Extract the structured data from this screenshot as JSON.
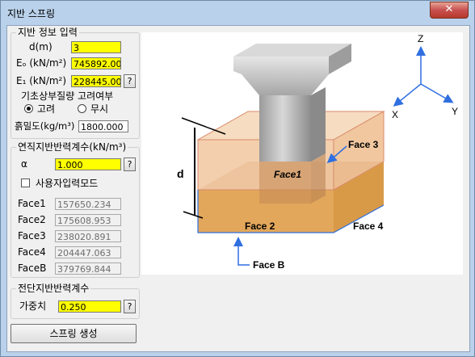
{
  "window": {
    "title": "지반 스프링",
    "close_label": "✕"
  },
  "soil_info": {
    "title": "지반 정보 입력",
    "d_label": "d(m)",
    "d_value": "3",
    "e0_label": "Eₒ (kN/m²)",
    "e0_value": "745892.000",
    "e1_label": "E₁ (kN/m²)",
    "e1_value": "228445.000",
    "e1_help": "?",
    "mass_label": "기초상부질량 고려여부",
    "radio_consider": "고려",
    "radio_ignore": "무시",
    "selected": "고려",
    "density_label": "흙밀도(kg/m³)",
    "density_value": "1800.000"
  },
  "vertical": {
    "title": "연직지반반력계수(kN/m³)",
    "alpha_label": "α",
    "alpha_value": "1.000",
    "alpha_help": "?",
    "user_mode_label": "사용자입력모드",
    "user_mode_checked": false,
    "faces": [
      {
        "label": "Face1",
        "value": "157650.234"
      },
      {
        "label": "Face2",
        "value": "175608.953"
      },
      {
        "label": "Face3",
        "value": "238020.891"
      },
      {
        "label": "Face4",
        "value": "204447.063"
      },
      {
        "label": "FaceB",
        "value": "379769.844"
      }
    ]
  },
  "shear": {
    "title": "전단지반반력계수",
    "weight_label": "가중치",
    "weight_value": "0.250",
    "weight_help": "?"
  },
  "generate_button": "스프링 생성",
  "diagram": {
    "axis_z": "Z",
    "axis_y": "Y",
    "axis_x": "X",
    "dim_d": "d",
    "face1": "Face1",
    "face2": "Face 2",
    "face3": "Face 3",
    "face4": "Face 4",
    "faceB": "Face B"
  },
  "colors": {
    "highlight": "#ffff00",
    "arrow": "#2f6fe0",
    "soil_top": "#efc28f",
    "soil_bottom": "#e0a652"
  }
}
